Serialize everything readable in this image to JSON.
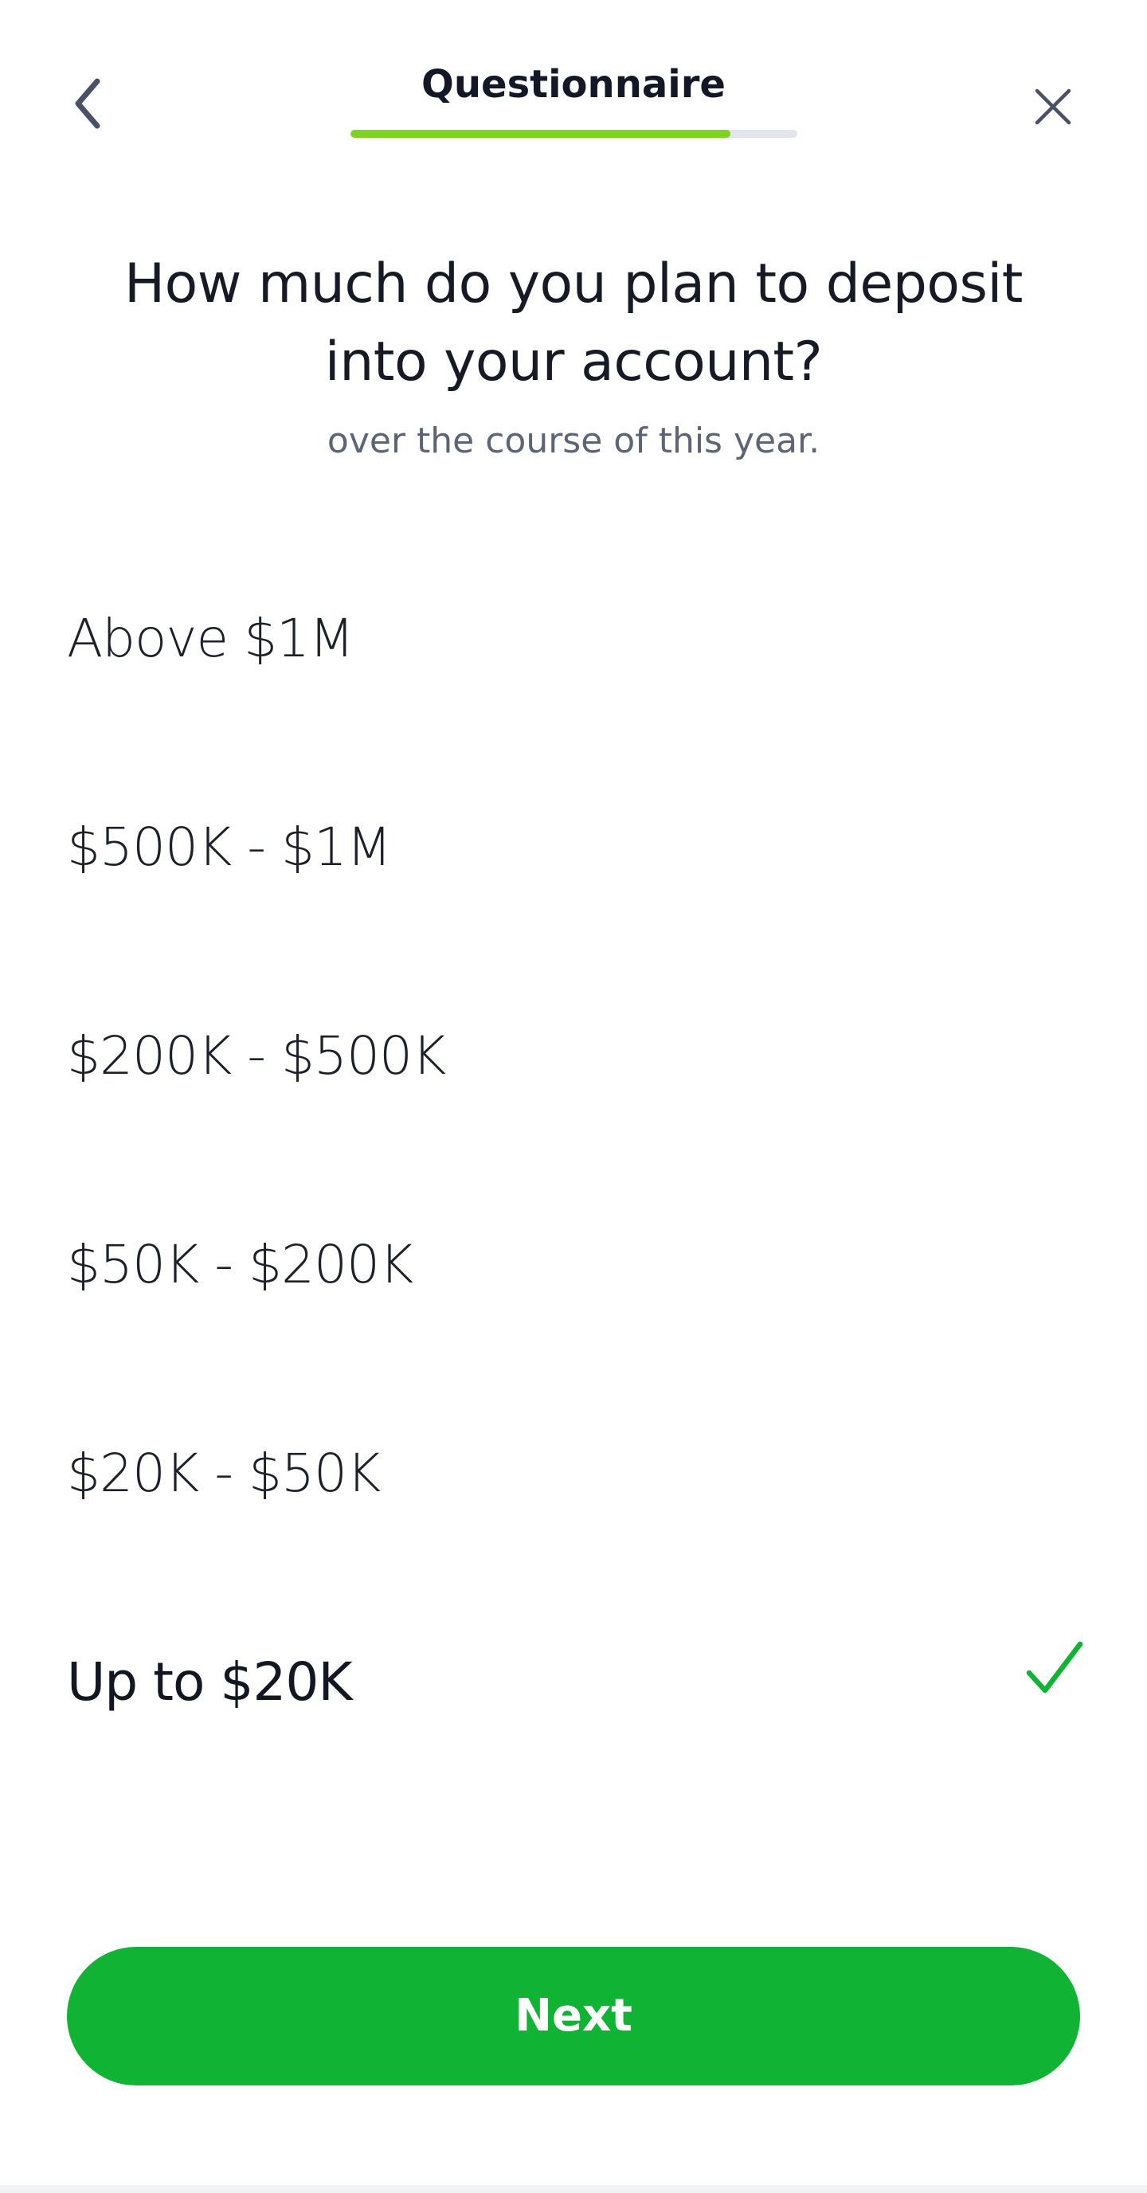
{
  "header": {
    "title": "Questionnaire",
    "progress": 0.85,
    "back_icon": "chevron-left-icon",
    "close_icon": "close-icon"
  },
  "question": {
    "title": "How much do you plan to deposit into your account?",
    "subtitle": "over the course of this year."
  },
  "options": [
    {
      "label": "Above $1M",
      "selected": false
    },
    {
      "label": "$500K - $1M",
      "selected": false
    },
    {
      "label": "$200K - $500K",
      "selected": false
    },
    {
      "label": "$50K - $200K",
      "selected": false
    },
    {
      "label": "$20K - $50K",
      "selected": false
    },
    {
      "label": "Up to $20K",
      "selected": true
    }
  ],
  "selected_icon": "checkmark-icon",
  "next_button": {
    "label": "Next"
  },
  "colors": {
    "accent_green": "#10b334",
    "progress_green": "#7ed321",
    "progress_track": "#e3e5ec",
    "icon_gray": "#4a5068",
    "text_dark": "#161a24",
    "subtitle_gray": "#5d6476"
  }
}
